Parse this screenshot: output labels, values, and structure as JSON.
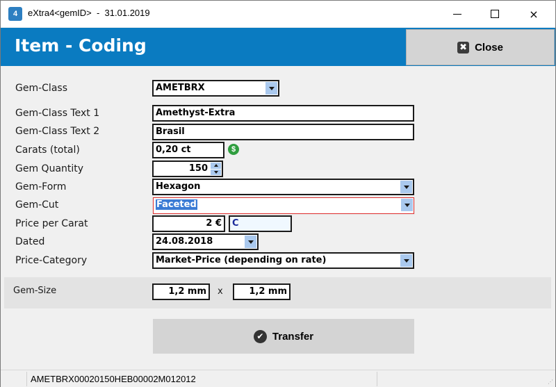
{
  "window": {
    "title": "eXtra4<gemID>  -  31.01.2019",
    "app_icon_text": "4",
    "controls": {
      "minimize": "minimize",
      "maximize": "maximize",
      "close": "×"
    }
  },
  "header": {
    "title": "Item - Coding",
    "close_button": {
      "label": "Close",
      "icon": "close-square-icon",
      "icon_glyph": "✖"
    }
  },
  "form": {
    "gem_class": {
      "label": "Gem-Class",
      "value": "AMETBRX"
    },
    "gem_class_text1": {
      "label": "Gem-Class Text 1",
      "value": "Amethyst-Extra"
    },
    "gem_class_text2": {
      "label": "Gem-Class Text 2",
      "value": "Brasil"
    },
    "carats": {
      "label": "Carats (total)",
      "value": "0,20 ct",
      "icon": "dollar-icon",
      "icon_glyph": "$"
    },
    "gem_quantity": {
      "label": "Gem Quantity",
      "value": "150"
    },
    "gem_form": {
      "label": "Gem-Form",
      "value": "Hexagon"
    },
    "gem_cut": {
      "label": "Gem-Cut",
      "value": "Faceted"
    },
    "price_per_carat": {
      "label": "Price per Carat",
      "value": "2 €",
      "currency_code": "C"
    },
    "dated": {
      "label": "Dated",
      "value": "24.08.2018"
    },
    "price_category": {
      "label": "Price-Category",
      "value": "Market-Price (depending on rate)"
    }
  },
  "gem_size": {
    "label": "Gem-Size",
    "width": "1,2 mm",
    "separator": "x",
    "height": "1,2 mm"
  },
  "transfer_button": {
    "label": "Transfer",
    "icon_glyph": "✔"
  },
  "statusbar": {
    "code": "AMETBRX00020150HEB00002M012012"
  }
}
